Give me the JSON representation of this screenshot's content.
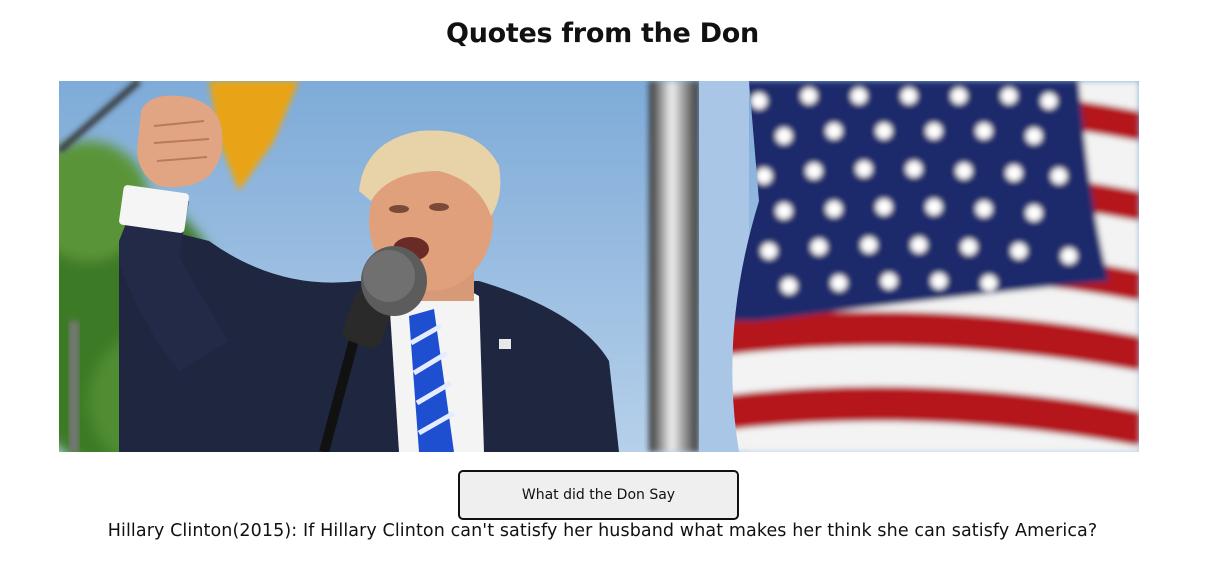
{
  "page": {
    "title": "Quotes from the Don"
  },
  "hero_image": {
    "description_icon": "photo-icon"
  },
  "button": {
    "label": "What did the Don Say"
  },
  "quote": {
    "text": "Hillary Clinton(2015): If Hillary Clinton can't satisfy her husband what makes her think she can satisfy America?"
  },
  "colors": {
    "sky": "#8fb6dc",
    "flag_red": "#b4141e",
    "flag_blue": "#1a2a6c",
    "suit": "#1f2640",
    "tie": "#1f4fd1",
    "foliage": "#3f7a2a",
    "button_bg": "#efefef"
  }
}
